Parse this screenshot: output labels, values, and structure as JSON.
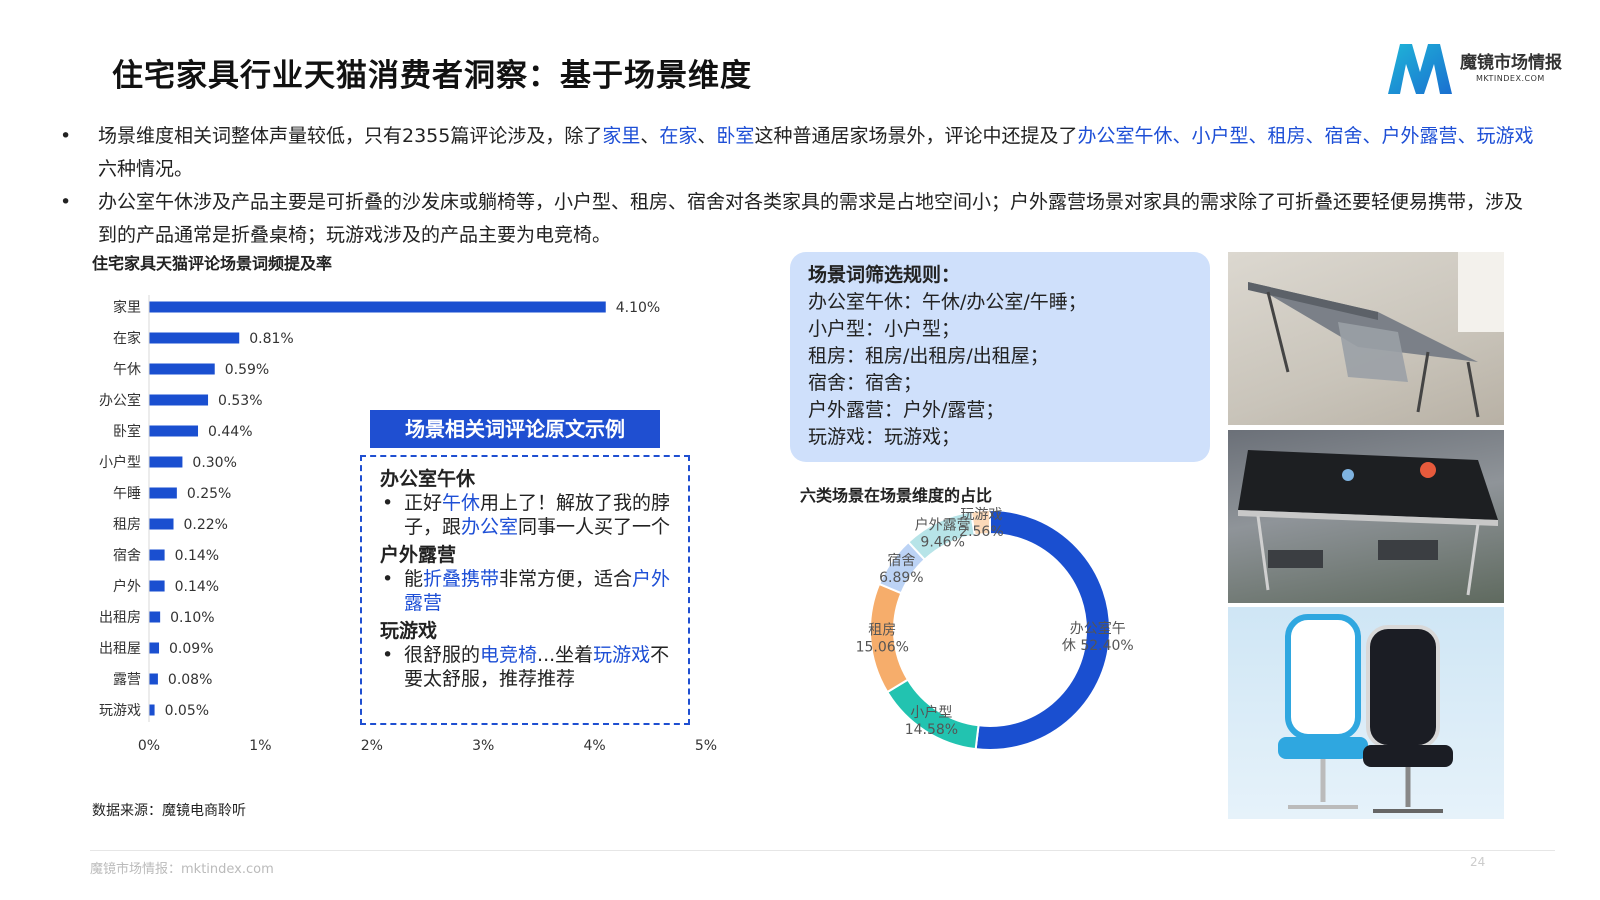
{
  "title": "住宅家具行业天猫消费者洞察：基于场景维度",
  "logo": {
    "main": "魔镜市场情报",
    "sub": "MKTINDEX.COM"
  },
  "bullets": [
    {
      "bullet": "•",
      "p1": "场景维度相关词整体声量较低，只有2355篇评论涉及，除了",
      "h1": "家里",
      "s1": "、",
      "h2": "在家",
      "s2": "、",
      "h3": "卧室",
      "p2": "这种普通居家场景外，评论中还提及了",
      "h4": "办公室午休、小户型、租房、宿舍、户外露营、玩游戏",
      "p3": "六种情况。"
    },
    {
      "bullet": "•",
      "text": "办公室午休涉及产品主要是可折叠的沙发床或躺椅等，小户型、租房、宿舍对各类家具的需求是占地空间小；户外露营场景对家具的需求除了可折叠还要轻便易携带，涉及到的产品通常是折叠桌椅；玩游戏涉及的产品主要为电竞椅。"
    }
  ],
  "examples": {
    "header": "场景相关词评论原文示例",
    "sections": [
      {
        "heading": "办公室午休",
        "bullet": "•",
        "parts": [
          {
            "t": "正好",
            "h": false
          },
          {
            "t": "午休",
            "h": true
          },
          {
            "t": "用上了！解放了我的脖子，跟",
            "h": false
          },
          {
            "t": "办公室",
            "h": true
          },
          {
            "t": "同事一人买了一个",
            "h": false
          }
        ]
      },
      {
        "heading": "户外露营",
        "bullet": "•",
        "parts": [
          {
            "t": "能",
            "h": false
          },
          {
            "t": "折叠携带",
            "h": true
          },
          {
            "t": "非常方便，适合",
            "h": false
          },
          {
            "t": "户外露营",
            "h": true
          }
        ]
      },
      {
        "heading": "玩游戏",
        "bullet": "•",
        "parts": [
          {
            "t": "很舒服的",
            "h": false
          },
          {
            "t": "电竞椅",
            "h": true
          },
          {
            "t": "...坐着",
            "h": false
          },
          {
            "t": "玩游戏",
            "h": true
          },
          {
            "t": "不要太舒服，推荐推荐",
            "h": false
          }
        ]
      }
    ]
  },
  "rules": {
    "title": "场景词筛选规则：",
    "lines": [
      "办公室午休：午休/办公室/午睡；",
      "小户型：小户型；",
      "租房：租房/出租房/出租屋；",
      "宿舍：宿舍；",
      "户外露营：户外/露营；",
      "玩游戏：玩游戏；"
    ]
  },
  "source": "数据来源：魔镜电商聆听",
  "footer": "魔镜市场情报：mktindex.com",
  "page_number": "24",
  "photos": [
    "folding-bed-photo",
    "folding-table-photo",
    "gaming-chair-photo"
  ],
  "chart_data": [
    {
      "type": "bar",
      "orientation": "horizontal",
      "title": "住宅家具天猫评论场景词频提及率",
      "categories": [
        "家里",
        "在家",
        "午休",
        "办公室",
        "卧室",
        "小户型",
        "午睡",
        "租房",
        "宿舍",
        "户外",
        "出租房",
        "出租屋",
        "露营",
        "玩游戏"
      ],
      "values": [
        4.1,
        0.81,
        0.59,
        0.53,
        0.44,
        0.3,
        0.25,
        0.22,
        0.14,
        0.14,
        0.1,
        0.09,
        0.08,
        0.05
      ],
      "value_labels": [
        "4.10%",
        "0.81%",
        "0.59%",
        "0.53%",
        "0.44%",
        "0.30%",
        "0.25%",
        "0.22%",
        "0.14%",
        "0.14%",
        "0.10%",
        "0.09%",
        "0.08%",
        "0.05%"
      ],
      "xlim": [
        0,
        5
      ],
      "xticks": [
        "0%",
        "1%",
        "2%",
        "3%",
        "4%",
        "5%"
      ],
      "grid": false,
      "bar_color": "#1a4fd0"
    },
    {
      "type": "pie",
      "donut": true,
      "title": "六类场景在场景维度的占比",
      "labels": [
        "办公室午休",
        "小户型",
        "租房",
        "宿舍",
        "户外露营",
        "玩游戏"
      ],
      "label_lines": [
        [
          "办公室午",
          "休 52.40%"
        ],
        [
          "小户型",
          "14.58%"
        ],
        [
          "租房",
          "15.06%"
        ],
        [
          "宿舍",
          "6.89%"
        ],
        [
          "户外露营",
          "9.46%"
        ],
        [
          "玩游戏",
          "2.56%"
        ]
      ],
      "values": [
        52.4,
        14.58,
        15.06,
        6.89,
        9.46,
        2.56
      ],
      "colors": [
        "#1a4fd0",
        "#22c3b0",
        "#f6ad6b",
        "#bcd3f5",
        "#b7e4e8",
        "#fbd9b9"
      ]
    }
  ]
}
